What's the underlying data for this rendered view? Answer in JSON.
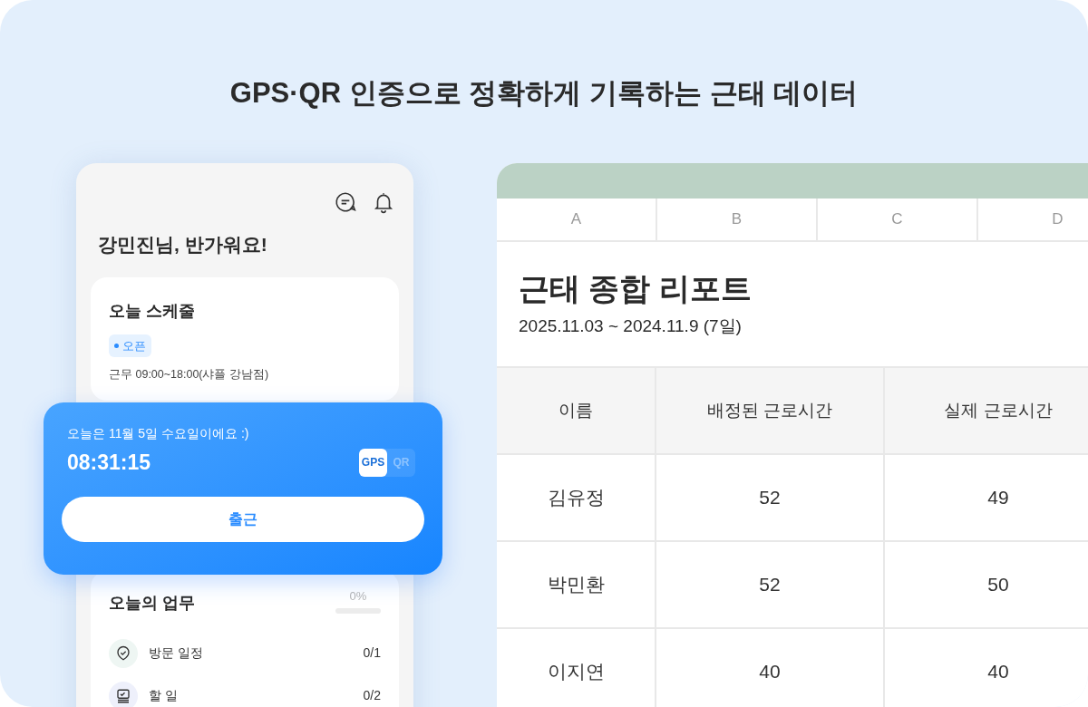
{
  "headline": "GPS·QR 인증으로 정확하게 기록하는 근태 데이터",
  "phone": {
    "greeting": "강민진님, 반가워요!",
    "schedule": {
      "title": "오늘 스케줄",
      "tag": "오픈",
      "hours": "근무 09:00~18:00(샤플 강남점)"
    },
    "checkin": {
      "date": "오늘은 11월 5일 수요일이에요 :)",
      "time": "08:31:15",
      "modes": [
        {
          "label": "GPS",
          "selected": true
        },
        {
          "label": "QR",
          "selected": false
        }
      ],
      "button": "출근"
    },
    "tasks": {
      "title": "오늘의 업무",
      "progress": "0%",
      "level": 0,
      "items": [
        {
          "kind": "visit",
          "label": "방문 일정",
          "count": "0/1"
        },
        {
          "kind": "todo",
          "label": "할 일",
          "count": "0/2"
        }
      ]
    }
  },
  "sheet": {
    "columns": [
      "A",
      "B",
      "C",
      "D"
    ],
    "title": "근태 종합 리포트",
    "period": "2025.11.03 ~ 2024.11.9 (7일)",
    "table": {
      "headers": [
        "이름",
        "배정된 근로시간",
        "실제 근로시간"
      ],
      "rows": [
        [
          "김유정",
          "52",
          "49"
        ],
        [
          "박민환",
          "52",
          "50"
        ],
        [
          "이지연",
          "40",
          "40"
        ]
      ]
    }
  }
}
